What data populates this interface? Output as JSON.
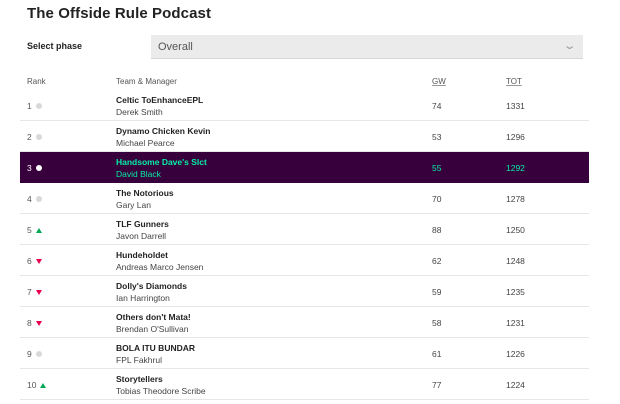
{
  "league": {
    "title": "The Offside Rule Podcast"
  },
  "phase": {
    "label": "Select phase",
    "selected": "Overall"
  },
  "table": {
    "headers": {
      "rank": "Rank",
      "team": "Team & Manager",
      "gw": "GW",
      "tot": "TOT"
    },
    "colors": {
      "highlight_bg": "#37003c",
      "highlight_text": "#05f0a6",
      "up": "#01a954",
      "down": "#e90052",
      "same": "#d9d9d9"
    },
    "rows": [
      {
        "rank": "1",
        "movement": "same",
        "team": "Celtic ToEnhanceEPL",
        "manager": "Derek Smith",
        "gw": "74",
        "tot": "1331",
        "highlight": false
      },
      {
        "rank": "2",
        "movement": "same",
        "team": "Dynamo Chicken Kevin",
        "manager": "Michael Pearce",
        "gw": "53",
        "tot": "1296",
        "highlight": false
      },
      {
        "rank": "3",
        "movement": "same",
        "team": "Handsome Dave's Slct",
        "manager": "David Black",
        "gw": "55",
        "tot": "1292",
        "highlight": true
      },
      {
        "rank": "4",
        "movement": "same",
        "team": "The Notorious",
        "manager": "Gary Lan",
        "gw": "70",
        "tot": "1278",
        "highlight": false
      },
      {
        "rank": "5",
        "movement": "up",
        "team": "TLF Gunners",
        "manager": "Javon Darrell",
        "gw": "88",
        "tot": "1250",
        "highlight": false
      },
      {
        "rank": "6",
        "movement": "down",
        "team": "Hundeholdet",
        "manager": "Andreas Marco Jensen",
        "gw": "62",
        "tot": "1248",
        "highlight": false
      },
      {
        "rank": "7",
        "movement": "down",
        "team": "Dolly's Diamonds",
        "manager": "Ian Harrington",
        "gw": "59",
        "tot": "1235",
        "highlight": false
      },
      {
        "rank": "8",
        "movement": "down",
        "team": "Others don't Mata!",
        "manager": "Brendan O'Sullivan",
        "gw": "58",
        "tot": "1231",
        "highlight": false
      },
      {
        "rank": "9",
        "movement": "same",
        "team": "BOLA ITU BUNDAR",
        "manager": "FPL Fakhrul",
        "gw": "61",
        "tot": "1226",
        "highlight": false
      },
      {
        "rank": "10",
        "movement": "up",
        "team": "Storytellers",
        "manager": "Tobias Theodore Scribe",
        "gw": "77",
        "tot": "1224",
        "highlight": false
      }
    ]
  }
}
